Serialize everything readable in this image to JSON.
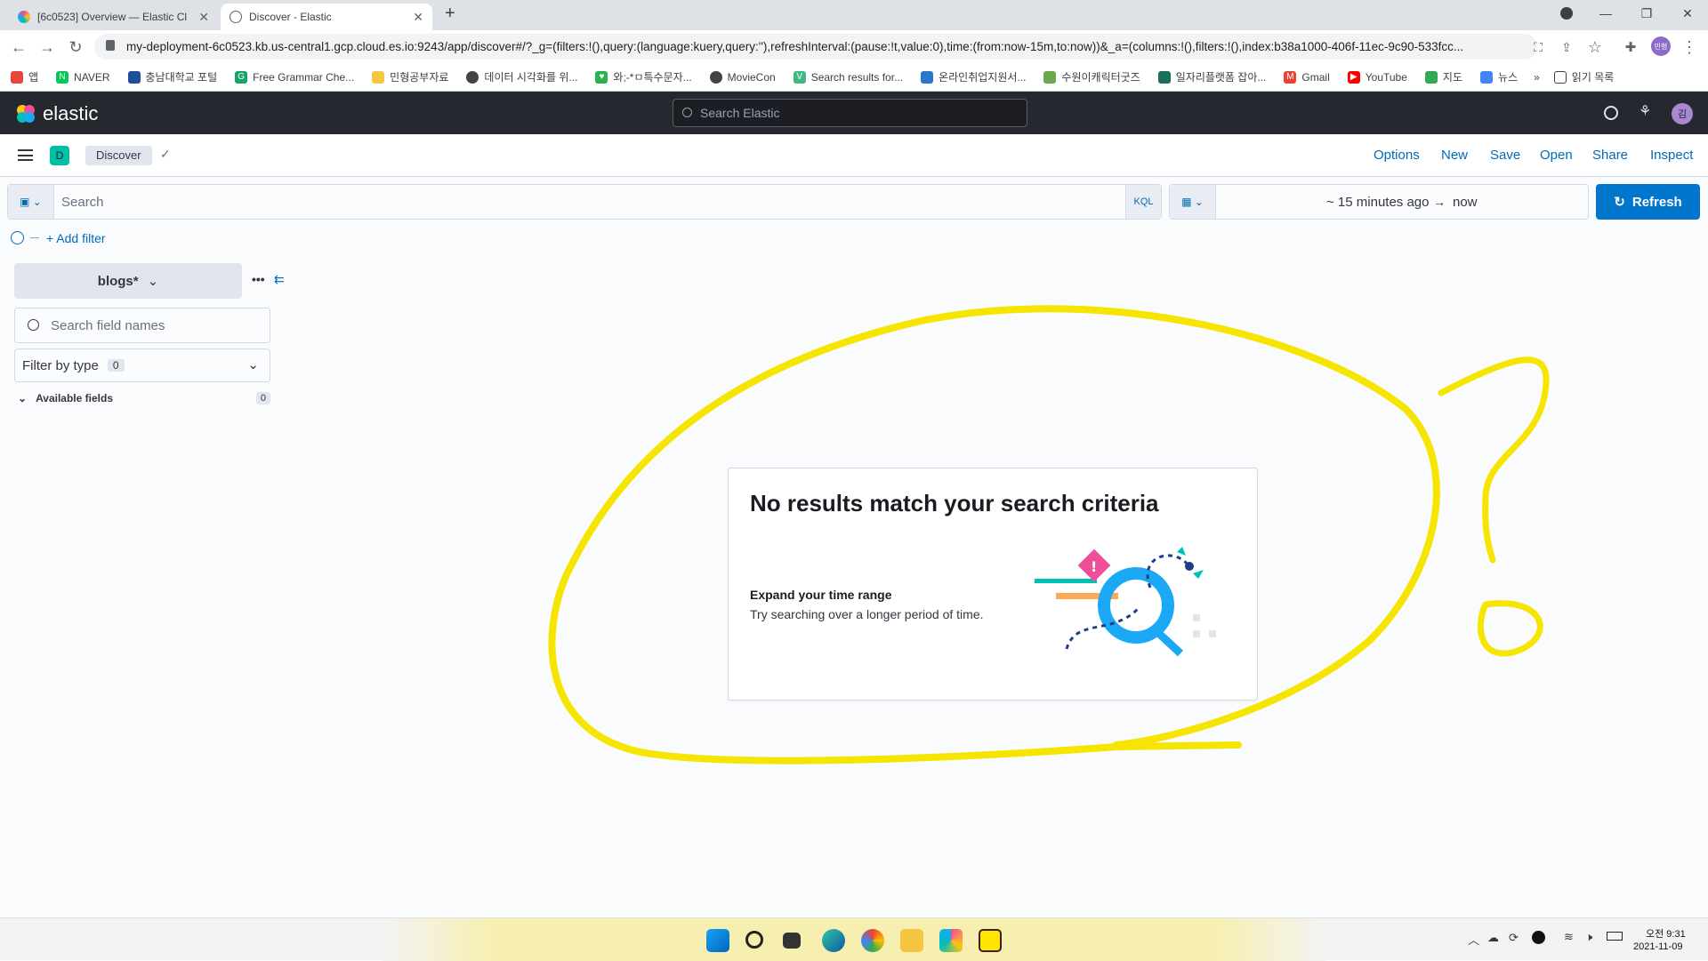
{
  "browser": {
    "tabs": [
      {
        "title": "[6c0523] Overview — Elastic Cl",
        "active": false
      },
      {
        "title": "Discover - Elastic",
        "active": true
      }
    ],
    "new_tab": "+",
    "url": "my-deployment-6c0523.kb.us-central1.gcp.cloud.es.io:9243/app/discover#/?_g=(filters:!(),query:(language:kuery,query:''),refreshInterval:(pause:!t,value:0),time:(from:now-15m,to:now))&_a=(columns:!(),filters:!(),index:b38a1000-406f-11ec-9c90-533fcc...",
    "bookmarks": [
      "앱",
      "NAVER",
      "충남대학교 포털",
      "Free Grammar Che...",
      "민형공부자료",
      "데이터 시각화를 위...",
      "와;-*ㅁ특수문자...",
      "MovieCon",
      "Search results for...",
      "온라인취업지원서...",
      "수원이캐릭터굿즈",
      "일자리플랫폼 잡아...",
      "Gmail",
      "YouTube",
      "지도",
      "뉴스",
      "»",
      "읽기 목록"
    ],
    "profile_badge": "민형"
  },
  "kibana": {
    "logo_text": "elastic",
    "global_search_placeholder": "Search Elastic",
    "user_avatar": "김",
    "space_badge": "D",
    "breadcrumb": "Discover",
    "top_nav": [
      "Options",
      "New",
      "Save",
      "Open",
      "Share",
      "Inspect"
    ],
    "query_placeholder": "Search",
    "query_language": "KQL",
    "time_start": "~ 15 minutes ago",
    "time_arrow": "→",
    "time_end": "now",
    "refresh_label": "Refresh",
    "add_filter": "+ Add filter",
    "index_pattern": "blogs*",
    "field_search_placeholder": "Search field names",
    "filter_by_type": "Filter by type",
    "filter_count": "0",
    "available_fields": "Available fields",
    "available_count": "0",
    "empty_title": "No results match your search criteria",
    "empty_subtitle": "Expand your time range",
    "empty_body": "Try searching over a longer period of time."
  },
  "annotation": {
    "color": "#f5e500"
  },
  "taskbar": {
    "time": "오전 9:31",
    "date": "2021-11-09"
  },
  "colors": {
    "primary": "#0077cc",
    "header": "#25282f",
    "badge": "#00bfa5"
  }
}
